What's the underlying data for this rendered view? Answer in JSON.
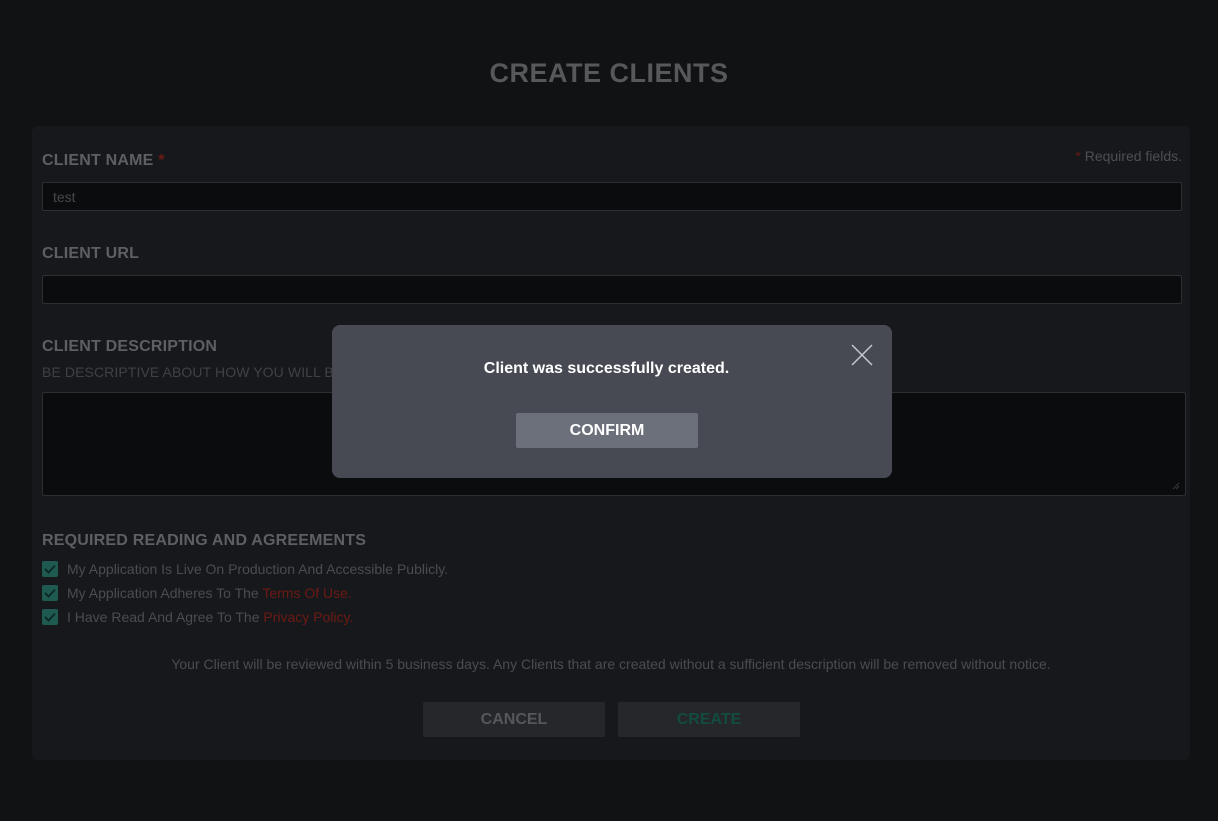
{
  "page": {
    "title": "CREATE CLIENTS"
  },
  "form": {
    "required_note_star": "*",
    "required_note": " Required fields.",
    "client_name": {
      "label": "CLIENT NAME",
      "star": "*",
      "value": "test"
    },
    "client_url": {
      "label": "CLIENT URL",
      "value": ""
    },
    "client_description": {
      "label": "CLIENT DESCRIPTION",
      "hint": "BE DESCRIPTIVE ABOUT HOW YOU WILL BE US",
      "value": ""
    },
    "agreements": {
      "label": "REQUIRED READING AND AGREEMENTS",
      "items": [
        {
          "text": "My Application Is Live On Production And Accessible Publicly.",
          "link": "",
          "suffix": "",
          "checked": true
        },
        {
          "text": "My Application Adheres To The ",
          "link": "Terms Of Use",
          "suffix": ".",
          "checked": true
        },
        {
          "text": "I Have Read And Agree To The ",
          "link": "Privacy Policy",
          "suffix": ".",
          "checked": true
        }
      ]
    },
    "notice": "Your Client will be reviewed within 5 business days. Any Clients that are created without a sufficient description will be removed without notice.",
    "cancel_label": "CANCEL",
    "create_label": "CREATE"
  },
  "modal": {
    "message": "Client was successfully created.",
    "confirm_label": "CONFIRM",
    "close_icon": "close-icon"
  },
  "colors": {
    "background": "#111214",
    "panel": "#17181b",
    "accent_red": "#6d1a14",
    "accent_green": "#1f5a50",
    "modal": "#474a53",
    "confirm": "#6c707b"
  }
}
